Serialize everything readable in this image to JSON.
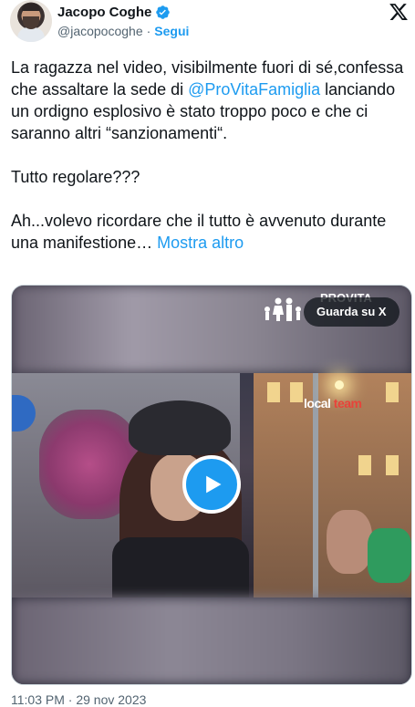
{
  "author": {
    "name": "Jacopo Coghe",
    "handle": "@jacopocoghe",
    "follow_label": "Segui",
    "verified_icon": "verified-badge-icon",
    "avatar_icon": "profile-avatar"
  },
  "brand_icon": "x-logo-icon",
  "tweet": {
    "line1": "La ragazza nel video, visibilmente fuori di sé,confessa che assaltare la sede di ",
    "mention": "@ProVitaFamiglia",
    "line1_after": " lanciando un ordigno esplosivo è stato troppo poco e che ci saranno altri “sanzionamenti“.",
    "para2": "Tutto regolare???",
    "para3": "Ah...volevo ricordare che il tutto è avvenuto durante una manifestione… ",
    "show_more": "Mostra altro"
  },
  "video": {
    "watch_on_x": "Guarda su X",
    "overlay_brand": "PROVITA",
    "watermark_main": "local",
    "watermark_accent": "team",
    "play_icon": "play-icon"
  },
  "timestamp": "11:03 PM · 29 nov 2023",
  "colors": {
    "accent": "#1d9bf0",
    "text": "#0f1419",
    "muted": "#536471"
  }
}
